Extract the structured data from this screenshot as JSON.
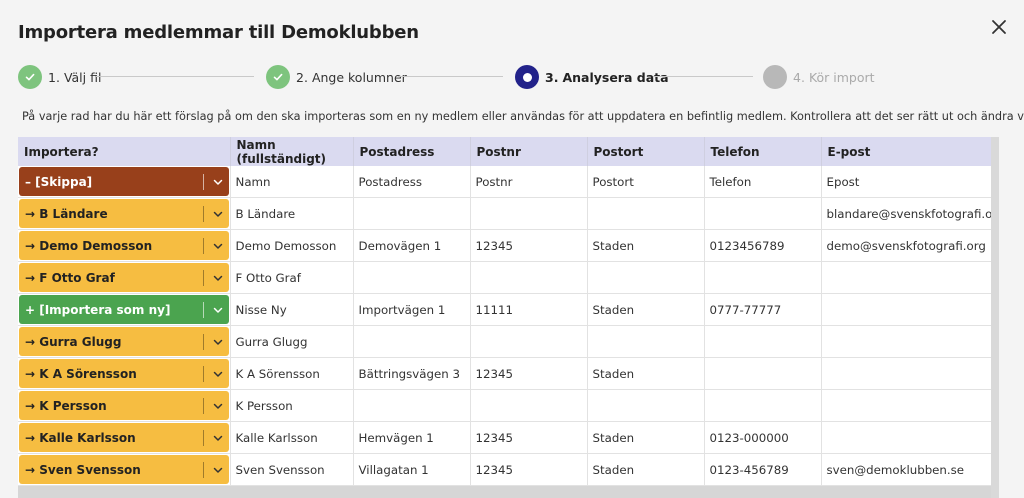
{
  "dialog": {
    "title": "Importera medlemmar till Demoklubben",
    "close_icon": "close-icon"
  },
  "steps": [
    {
      "num": "1.",
      "label": "Välj fil",
      "state": "done"
    },
    {
      "num": "2.",
      "label": "Ange kolumner",
      "state": "done"
    },
    {
      "num": "3.",
      "label": "Analysera data",
      "state": "active"
    },
    {
      "num": "4.",
      "label": "Kör import",
      "state": "pending"
    }
  ],
  "info": {
    "icon": "info-icon",
    "text": "På varje rad har du här ett förslag på om den ska importeras som en ny medlem eller användas för att uppdatera en befintlig medlem. Kontrollera att det ser rätt ut och ändra vid behov."
  },
  "colors": {
    "skip": "#98401b",
    "update": "#f6bd41",
    "new": "#4ba44f",
    "active_step": "#22228a",
    "done_step": "#7ec47e",
    "header_bg": "#dadaf0"
  },
  "table": {
    "headers": [
      "Importera?",
      "Namn (fullständigt)",
      "Postadress",
      "Postnr",
      "Postort",
      "Telefon",
      "E-post"
    ],
    "rows": [
      {
        "action": "– [Skippa]",
        "type": "skip",
        "cells": [
          "Namn",
          "Postadress",
          "Postnr",
          "Postort",
          "Telefon",
          "Epost"
        ]
      },
      {
        "action": "→ B Ländare",
        "type": "update",
        "cells": [
          "B Ländare",
          "",
          "",
          "",
          "",
          "blandare@svenskfotografi.org"
        ]
      },
      {
        "action": "→ Demo Demosson",
        "type": "update",
        "cells": [
          "Demo Demosson",
          "Demovägen 1",
          "12345",
          "Staden",
          "0123456789",
          "demo@svenskfotografi.org"
        ]
      },
      {
        "action": "→ F Otto Graf",
        "type": "update",
        "cells": [
          "F Otto Graf",
          "",
          "",
          "",
          "",
          ""
        ]
      },
      {
        "action": "+ [Importera som ny]",
        "type": "new",
        "cells": [
          "Nisse Ny",
          "Importvägen 1",
          "11111",
          "Staden",
          "0777-77777",
          ""
        ]
      },
      {
        "action": "→ Gurra Glugg",
        "type": "update",
        "cells": [
          "Gurra Glugg",
          "",
          "",
          "",
          "",
          ""
        ]
      },
      {
        "action": "→ K A Sörensson",
        "type": "update",
        "cells": [
          "K A Sörensson",
          "Bättringsvägen 3",
          "12345",
          "Staden",
          "",
          ""
        ]
      },
      {
        "action": "→ K Persson",
        "type": "update",
        "cells": [
          "K Persson",
          "",
          "",
          "",
          "",
          ""
        ]
      },
      {
        "action": "→ Kalle Karlsson",
        "type": "update",
        "cells": [
          "Kalle Karlsson",
          "Hemvägen 1",
          "12345",
          "Staden",
          "0123-000000",
          ""
        ]
      },
      {
        "action": "→ Sven Svensson",
        "type": "update",
        "cells": [
          "Sven Svensson",
          "Villagatan 1",
          "12345",
          "Staden",
          "0123-456789",
          "sven@demoklubben.se"
        ]
      }
    ]
  }
}
